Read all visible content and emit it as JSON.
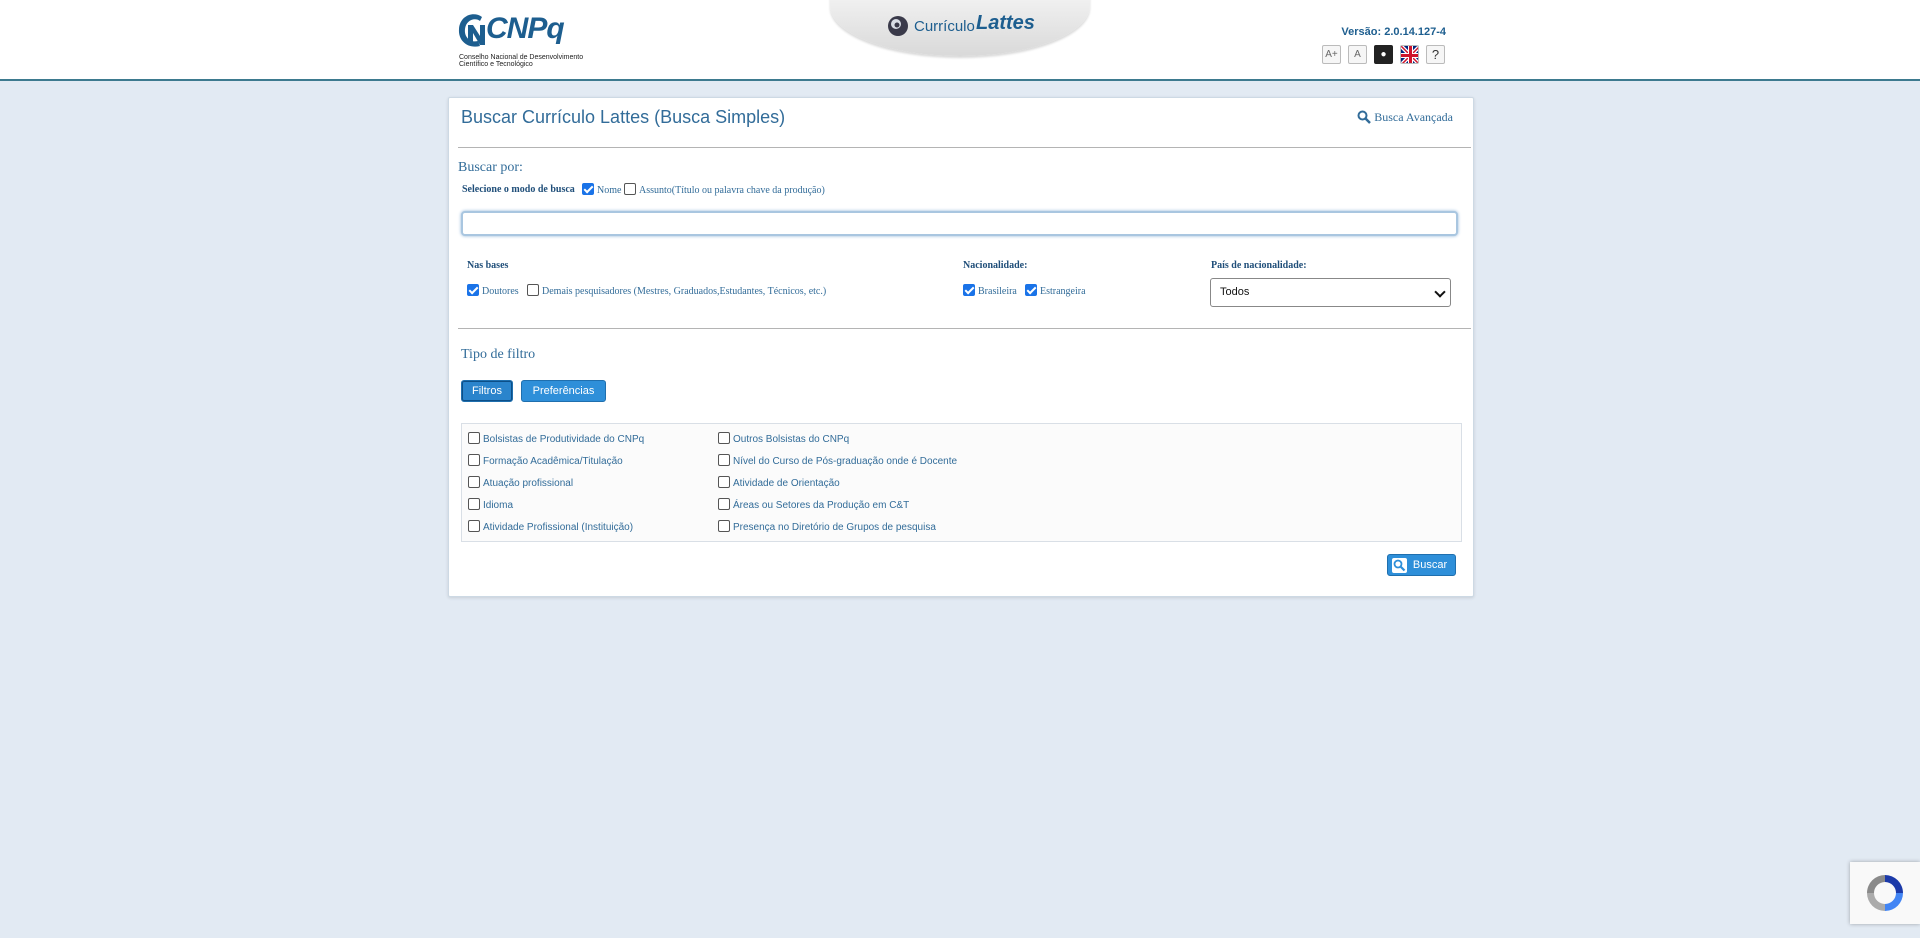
{
  "header": {
    "logo_text": "CNPq",
    "logo_subtitle": "Conselho Nacional de Desenvolvimento Científico e Tecnológico",
    "app_title_prefix": "Currículo",
    "app_title_main": "Lattes",
    "version": "Versão: 2.0.14.127-4",
    "tools": {
      "increase_font": "A+",
      "normal_font": "A",
      "contrast": "●",
      "help": "?"
    }
  },
  "panel": {
    "title": "Buscar Currículo Lattes (Busca Simples)",
    "advanced_link": "Busca Avançada",
    "buscar_por": "Buscar por:",
    "modo_label": "Selecione o modo de busca",
    "modo_options": [
      {
        "label": "Nome",
        "checked": true
      },
      {
        "label": "Assunto(Título ou palavra chave da produção)",
        "checked": false
      }
    ],
    "search_value": "",
    "bases_label": "Nas bases",
    "bases_options": [
      {
        "label": "Doutores",
        "checked": true
      },
      {
        "label": "Demais pesquisadores (Mestres, Graduados,Estudantes, Técnicos, etc.)",
        "checked": false
      }
    ],
    "nacionalidade_label": "Nacionalidade:",
    "nacionalidade_options": [
      {
        "label": "Brasileira",
        "checked": true
      },
      {
        "label": "Estrangeira",
        "checked": true
      }
    ],
    "pais_label": "País de nacionalidade:",
    "pais_selected": "Todos",
    "tipo_filtro": "Tipo de filtro",
    "tabs": {
      "filtros": "Filtros",
      "preferencias": "Preferências"
    },
    "filters_left": [
      "Bolsistas de Produtividade do CNPq",
      "Formação Acadêmica/Titulação",
      "Atuação profissional",
      "Idioma",
      "Atividade Profissional (Instituição)"
    ],
    "filters_right": [
      "Outros Bolsistas do CNPq",
      "Nível do Curso de Pós-graduação onde é Docente",
      "Atividade de Orientação",
      "Áreas ou Setores da Produção em C&T",
      "Presença no Diretório de Grupos de pesquisa"
    ],
    "buscar_button": "Buscar"
  },
  "colors": {
    "background": "#e2eaf3",
    "text": "#326c99",
    "button": "#2e8fd9",
    "header_border": "#3d7a8f"
  }
}
